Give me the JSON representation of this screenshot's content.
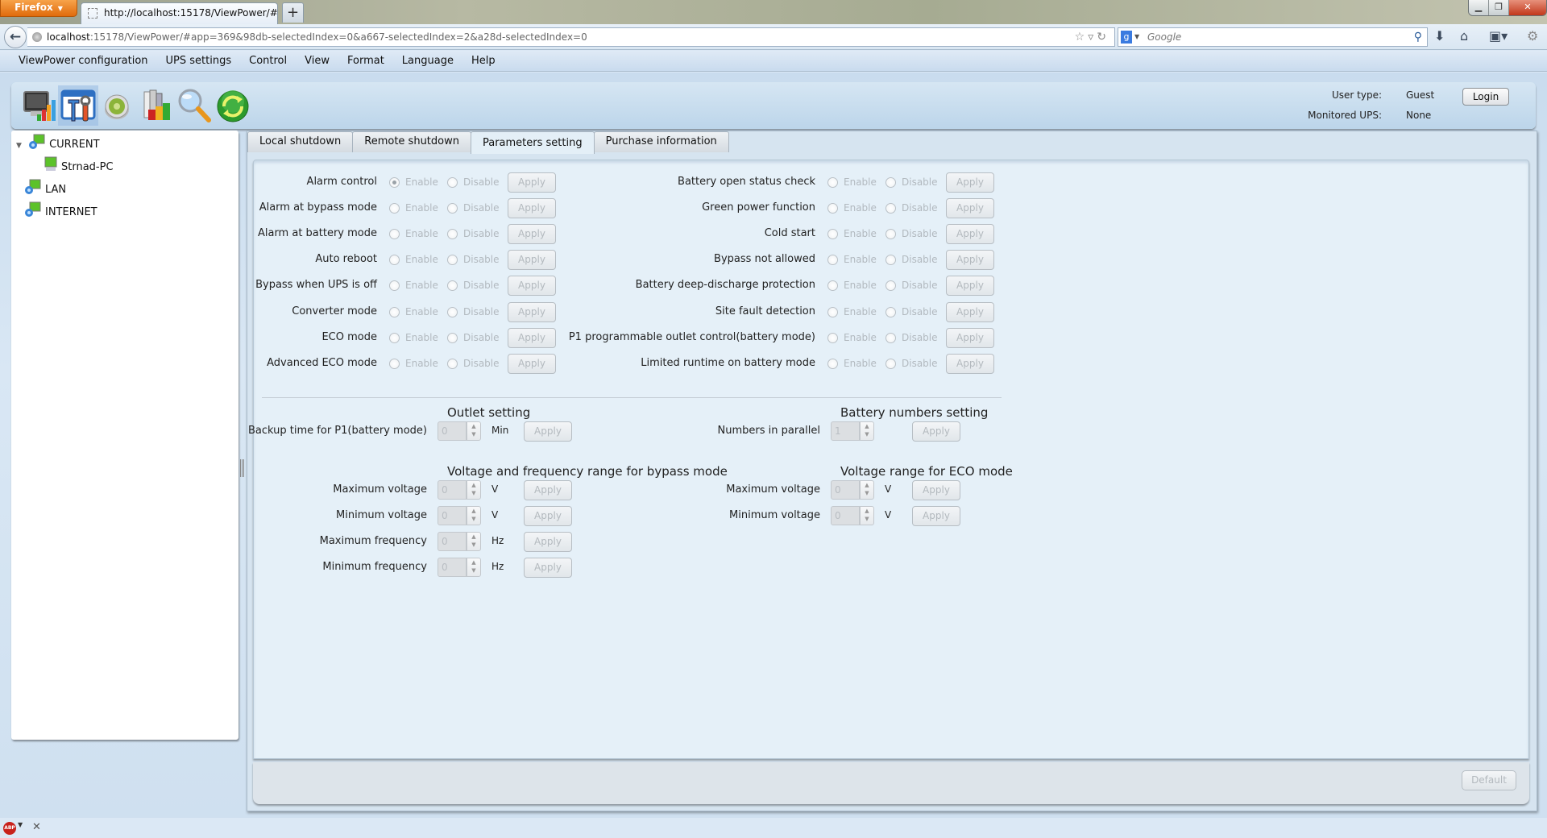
{
  "browser": {
    "menu_button": "Firefox",
    "tab_title": "http://localhost:15178/ViewPower/#",
    "new_tab": "+",
    "url_host": "localhost",
    "url_rest": ":15178/ViewPower/#app=369&98db-selectedIndex=0&a667-selectedIndex=2&a28d-selectedIndex=0",
    "search_placeholder": "Google",
    "search_engine_icon": "g-icon"
  },
  "menubar": {
    "items": [
      "ViewPower configuration",
      "UPS settings",
      "Control",
      "View",
      "Format",
      "Language",
      "Help"
    ]
  },
  "toolbar": {
    "icons": [
      "monitor-chart-icon",
      "tools-icon",
      "gear-button-icon",
      "books-chart-icon",
      "magnifier-icon",
      "refresh-icon"
    ],
    "active_index": 1
  },
  "userinfo": {
    "user_type_label": "User type:",
    "user_type_value": "Guest",
    "monitored_label": "Monitored UPS:",
    "monitored_value": "None",
    "login_button": "Login"
  },
  "tree": {
    "items": [
      {
        "label": "CURRENT",
        "level": 0,
        "expanded": true
      },
      {
        "label": "Strnad-PC",
        "level": 1
      },
      {
        "label": "LAN",
        "level": 0
      },
      {
        "label": "INTERNET",
        "level": 0
      }
    ]
  },
  "tabs": {
    "items": [
      "Local shutdown",
      "Remote shutdown",
      "Parameters setting",
      "Purchase information"
    ],
    "active_index": 2
  },
  "params": {
    "enable_label": "Enable",
    "disable_label": "Disable",
    "apply_label": "Apply",
    "left": [
      {
        "label": "Alarm control",
        "selected": "enable"
      },
      {
        "label": "Alarm at bypass mode",
        "selected": null
      },
      {
        "label": "Alarm at battery mode",
        "selected": null
      },
      {
        "label": "Auto reboot",
        "selected": null
      },
      {
        "label": "Bypass when UPS is off",
        "selected": null
      },
      {
        "label": "Converter mode",
        "selected": null
      },
      {
        "label": "ECO mode",
        "selected": null
      },
      {
        "label": "Advanced ECO mode",
        "selected": null
      }
    ],
    "right": [
      {
        "label": "Battery open status check",
        "selected": null
      },
      {
        "label": "Green power function",
        "selected": null
      },
      {
        "label": "Cold start",
        "selected": null
      },
      {
        "label": "Bypass not allowed",
        "selected": null
      },
      {
        "label": "Battery deep-discharge protection",
        "selected": null
      },
      {
        "label": "Site fault detection",
        "selected": null
      },
      {
        "label": "P1 programmable outlet control(battery mode)",
        "selected": null
      },
      {
        "label": "Limited runtime on battery mode",
        "selected": null
      }
    ]
  },
  "outlet": {
    "title": "Outlet setting",
    "rows": [
      {
        "label": "Backup time for P1(battery mode)",
        "value": "0",
        "unit": "Min"
      }
    ]
  },
  "battery": {
    "title": "Battery numbers setting",
    "rows": [
      {
        "label": "Numbers in parallel",
        "value": "1",
        "unit": ""
      }
    ]
  },
  "bypass_range": {
    "title": "Voltage and frequency range for bypass mode",
    "rows": [
      {
        "label": "Maximum voltage",
        "value": "0",
        "unit": "V"
      },
      {
        "label": "Minimum voltage",
        "value": "0",
        "unit": "V"
      },
      {
        "label": "Maximum frequency",
        "value": "0",
        "unit": "Hz"
      },
      {
        "label": "Minimum frequency",
        "value": "0",
        "unit": "Hz"
      }
    ]
  },
  "eco_range": {
    "title": "Voltage range for ECO mode",
    "rows": [
      {
        "label": "Maximum voltage",
        "value": "0",
        "unit": "V"
      },
      {
        "label": "Minimum voltage",
        "value": "0",
        "unit": "V"
      }
    ]
  },
  "footer": {
    "default_button": "Default"
  },
  "statusbar": {
    "addon": "ABP"
  }
}
